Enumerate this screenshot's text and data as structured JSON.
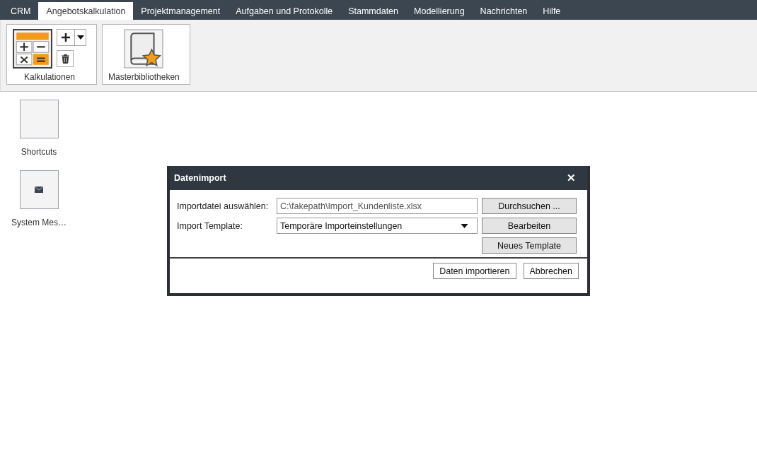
{
  "menu": [
    {
      "label": "CRM",
      "selected": false
    },
    {
      "label": "Angebotskalkulation",
      "selected": true
    },
    {
      "label": "Projektmanagement",
      "selected": false
    },
    {
      "label": "Aufgaben und Protokolle",
      "selected": false
    },
    {
      "label": "Stammdaten",
      "selected": false
    },
    {
      "label": "Modellierung",
      "selected": false
    },
    {
      "label": "Nachrichten",
      "selected": false
    },
    {
      "label": "Hilfe",
      "selected": false
    }
  ],
  "ribbon": [
    {
      "kind": "calc",
      "label": "Kalkulationen"
    },
    {
      "kind": "library",
      "label": "Masterbibliotheken"
    }
  ],
  "tiles": [
    {
      "kind": "empty",
      "label": "Shortcuts"
    },
    {
      "kind": "mail",
      "label": "System Mes…"
    }
  ],
  "dialog": {
    "title": "Datenimport",
    "close": "✕",
    "file_label": "Importdatei auswählen:",
    "file_value": "C:\\fakepath\\Import_Kundenliste.xlsx",
    "browse": "Durchsuchen ...",
    "template_label": "Import Template:",
    "template_value": "Temporäre Importeinstellungen",
    "edit": "Bearbeiten",
    "new_template": "Neues Template",
    "import": "Daten importieren",
    "cancel": "Abbrechen"
  }
}
